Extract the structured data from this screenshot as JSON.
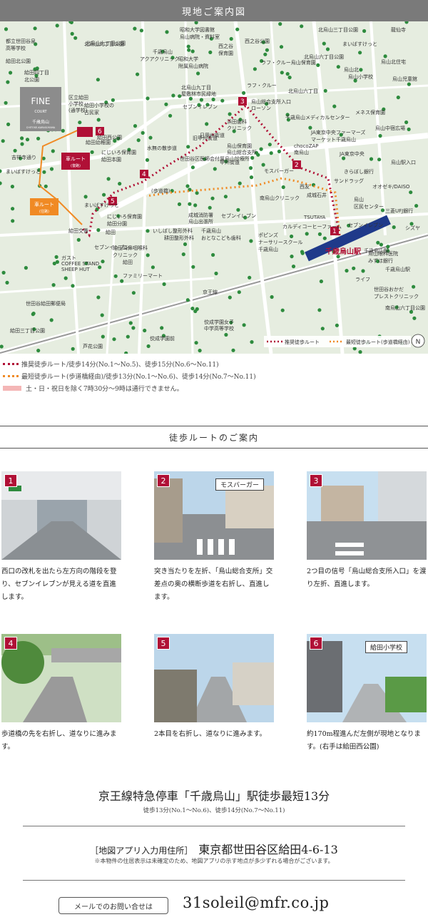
{
  "header": {
    "title": "現地ご案内図"
  },
  "map": {
    "labels": [
      {
        "id": "l1",
        "text": "北烏山九丁目公園"
      },
      {
        "id": "l2",
        "text": "昭和大学図書館"
      },
      {
        "id": "l3",
        "text": "烏山病院・資料室"
      },
      {
        "id": "l4",
        "text": "西之谷公園"
      },
      {
        "id": "l5",
        "text": "北烏山三丁目公園"
      },
      {
        "id": "l6",
        "text": "龍仙寺"
      },
      {
        "id": "l7",
        "text": "都立世田谷泉"
      },
      {
        "id": "l8",
        "text": "高等学校"
      },
      {
        "id": "l9",
        "text": "北烏山九丁目公園"
      },
      {
        "id": "l10",
        "text": "給田北公園"
      },
      {
        "id": "l11",
        "text": "千歳烏山"
      },
      {
        "id": "l12",
        "text": "アクアクリニック"
      },
      {
        "id": "l13",
        "text": "昭和大学"
      },
      {
        "id": "l14",
        "text": "附属烏山病院"
      },
      {
        "id": "l15",
        "text": "西之谷"
      },
      {
        "id": "l16",
        "text": "保育園"
      },
      {
        "id": "l17",
        "text": "まいばすけっと"
      },
      {
        "id": "l18",
        "text": "北烏山六丁目公園"
      },
      {
        "id": "l19",
        "text": "ラフ・クルー烏山保育園"
      },
      {
        "id": "l20",
        "text": "烏山小学校"
      },
      {
        "id": "l21",
        "text": "給田四丁目"
      },
      {
        "id": "l22",
        "text": "北公園"
      },
      {
        "id": "l23",
        "text": "区立給田"
      },
      {
        "id": "l24",
        "text": "小学校"
      },
      {
        "id": "l25",
        "text": "(通学校)"
      },
      {
        "id": "l26",
        "text": "給田小学校の"
      },
      {
        "id": "l27",
        "text": "古民家"
      },
      {
        "id": "l28",
        "text": "北烏山九丁目"
      },
      {
        "id": "l29",
        "text": "屋敷林市民緑地"
      },
      {
        "id": "l30",
        "text": "ラフ・クルー"
      },
      {
        "id": "l31",
        "text": "北烏山六丁目"
      },
      {
        "id": "l32",
        "text": "烏山北住宅"
      },
      {
        "id": "l33",
        "text": "烏山児童館"
      },
      {
        "id": "l34",
        "text": "セブンイレブン"
      },
      {
        "id": "l35",
        "text": "烏山総合支所入口"
      },
      {
        "id": "l36",
        "text": "ローソン"
      },
      {
        "id": "l37",
        "text": "千歳烏山メディカルセンター"
      },
      {
        "id": "l38",
        "text": "メネス保育園"
      },
      {
        "id": "l39",
        "text": "烏山中宿広場"
      },
      {
        "id": "l40",
        "text": "浜田歯科"
      },
      {
        "id": "l41",
        "text": "クリニック"
      },
      {
        "id": "l42",
        "text": "JA東京中央ファーマーズ"
      },
      {
        "id": "l43",
        "text": "マーケット千歳烏山"
      },
      {
        "id": "l44",
        "text": "烏山保育園"
      },
      {
        "id": "l45",
        "text": "烏山総合支所"
      },
      {
        "id": "l46",
        "text": "世田谷区医師会付属烏山診療所"
      },
      {
        "id": "l47",
        "text": "chocoZAP"
      },
      {
        "id": "l48",
        "text": "南烏山"
      },
      {
        "id": "l49",
        "text": "JA東京中央"
      },
      {
        "id": "l50",
        "text": "日甲州街道"
      },
      {
        "id": "l51",
        "text": "烏山駅入口"
      },
      {
        "id": "l52",
        "text": "給田幼稚園"
      },
      {
        "id": "l53",
        "text": "給田西公園"
      },
      {
        "id": "l54",
        "text": "にじいろ保育園"
      },
      {
        "id": "l55",
        "text": "給田本園"
      },
      {
        "id": "l56",
        "text": "吉祥寺通り"
      },
      {
        "id": "l57",
        "text": "まいばすけっと"
      },
      {
        "id": "l58",
        "text": "水無の散歩道"
      },
      {
        "id": "l59",
        "text": "甲州街道"
      },
      {
        "id": "l60",
        "text": "(歩道橋)"
      },
      {
        "id": "l61",
        "text": "モスバーガー"
      },
      {
        "id": "l62",
        "text": "南烏山クリニック"
      },
      {
        "id": "l63",
        "text": "西友"
      },
      {
        "id": "l64",
        "text": "成城石井"
      },
      {
        "id": "l65",
        "text": "サンドラッグ"
      },
      {
        "id": "l66",
        "text": "きらぼし銀行"
      },
      {
        "id": "l67",
        "text": "オオゼキ/DAISO"
      },
      {
        "id": "l68",
        "text": "烏山"
      },
      {
        "id": "l69",
        "text": "区民センター"
      },
      {
        "id": "l70",
        "text": "三菱UFJ銀行"
      },
      {
        "id": "l71",
        "text": "まいばすけっと"
      },
      {
        "id": "l72",
        "text": "成城消防署"
      },
      {
        "id": "l73",
        "text": "烏山出張所"
      },
      {
        "id": "l74",
        "text": "セブンイレブン"
      },
      {
        "id": "l75",
        "text": "TSUTAYA"
      },
      {
        "id": "l76",
        "text": "カルディコーヒーファーム"
      },
      {
        "id": "l77",
        "text": "セブンイレブン"
      },
      {
        "id": "l78",
        "text": "シズヤ"
      },
      {
        "id": "l79",
        "text": "給田交番"
      },
      {
        "id": "l80",
        "text": "給田"
      },
      {
        "id": "l81",
        "text": "にじいろ保育園"
      },
      {
        "id": "l82",
        "text": "給田分園"
      },
      {
        "id": "l83",
        "text": "いしばし整形外科"
      },
      {
        "id": "l84",
        "text": "耕田整形外科"
      },
      {
        "id": "l85",
        "text": "千歳烏山"
      },
      {
        "id": "l86",
        "text": "おとなこども歯科"
      },
      {
        "id": "l87",
        "text": "ポピンズ"
      },
      {
        "id": "l88",
        "text": "ナーサリースクール"
      },
      {
        "id": "l89",
        "text": "千歳烏山"
      },
      {
        "id": "l90",
        "text": "千歳烏山駅"
      },
      {
        "id": "l91",
        "text": "烏山眼科医院"
      },
      {
        "id": "l92",
        "text": "みずほ銀行"
      },
      {
        "id": "l93",
        "text": "千歳烏山駅"
      },
      {
        "id": "l94",
        "text": "セブンイレブン"
      },
      {
        "id": "l95",
        "text": "給田耳鼻咽喉科"
      },
      {
        "id": "l96",
        "text": "クリニック"
      },
      {
        "id": "l97",
        "text": "ガスト"
      },
      {
        "id": "l98",
        "text": "COFFEE STAND"
      },
      {
        "id": "l99",
        "text": "SHEEP HUT"
      },
      {
        "id": "l100",
        "text": "給田"
      },
      {
        "id": "l101",
        "text": "ファミリーマート"
      },
      {
        "id": "l102",
        "text": "ライフ"
      },
      {
        "id": "l103",
        "text": "世田谷おかだ"
      },
      {
        "id": "l104",
        "text": "プレストクリニック"
      },
      {
        "id": "l105",
        "text": "南烏山六丁目公園"
      },
      {
        "id": "l106",
        "text": "世田谷給田郵便局"
      },
      {
        "id": "l107",
        "text": "京王線"
      },
      {
        "id": "l108",
        "text": "給田三丁目公園"
      },
      {
        "id": "l109",
        "text": "佼成学園女子"
      },
      {
        "id": "l110",
        "text": "中学高等学校"
      },
      {
        "id": "l111",
        "text": "佼成学園前"
      },
      {
        "id": "l112",
        "text": "芦花公園"
      },
      {
        "id": "l113",
        "text": "烏山北"
      },
      {
        "id": "l114",
        "text": "旧甲州街道"
      }
    ],
    "property": {
      "brand": "FINE",
      "sub": "COURT",
      "place": "千歳烏山",
      "place_en": "CHITOSE-KARASUYAMA"
    },
    "station_label": "千歳烏山駅",
    "car_route_1": "車ルート",
    "car_route_1_sub": "(復路)",
    "car_route_2": "車ルート",
    "car_route_2_sub": "(往路)",
    "legend_walk": "推奨徒歩ルート",
    "legend_bridge": "最短徒歩ルート(歩道橋経由)",
    "north": "N",
    "markers": [
      "1",
      "2",
      "3",
      "4",
      "5",
      "6"
    ]
  },
  "legend": {
    "row1": "推奨徒歩ルート/徒歩14分(No.1〜No.5)、徒歩15分(No.6〜No.11)",
    "row2": "最短徒歩ルート(歩道橋経由)/徒歩13分(No.1〜No.6)、徒歩14分(No.7〜No.11)",
    "row3": "土・日・祝日を除く7時30分〜9時は通行できません。"
  },
  "route_section": {
    "title": "徒歩ルートのご案内",
    "steps": [
      {
        "num": "1",
        "caption": "西口の改札を出たら左方向の階段を登り、セブンイレブンが見える道を直進します。",
        "tag": ""
      },
      {
        "num": "2",
        "caption": "突き当たりを左折、「烏山総合支所」交差点の奥の横断歩道を右折し、直進します。",
        "tag": "モスバーガー"
      },
      {
        "num": "3",
        "caption": "2つ目の信号「烏山総合支所入口」を渡り左折、直進します。",
        "tag": ""
      },
      {
        "num": "4",
        "caption": "歩道橋の先を右折し、道なりに進みます。",
        "tag": ""
      },
      {
        "num": "5",
        "caption": "2本目を右折し、道なりに進みます。",
        "tag": ""
      },
      {
        "num": "6",
        "caption": "約170m程進んだ左側が現地となります。(右手は給田西公園)",
        "tag": "給田小学校"
      }
    ]
  },
  "access": {
    "main": "京王線特急停車「千歳烏山」駅徒歩最短13分",
    "sub": "徒歩13分(No.1〜No.6)、徒歩14分(No.7〜No.11)"
  },
  "address": {
    "label": "［地図アプリ入力用住所］",
    "value": "東京都世田谷区給田4-6-13",
    "note": "※本物件の住居表示は未確定のため、地図アプリの示す地点が多少ずれる場合がございます。"
  },
  "contact": {
    "button": "メールでのお問い合せは",
    "email": "31soleil@mfr.co.jp"
  },
  "colors": {
    "route_red": "#b01036",
    "route_orange": "#f08a24",
    "map_bg": "#e6ede0",
    "road": "#ffffff",
    "green": "#2e8b3e",
    "station": "#1f3a8a",
    "header": "#7a7a7a"
  }
}
